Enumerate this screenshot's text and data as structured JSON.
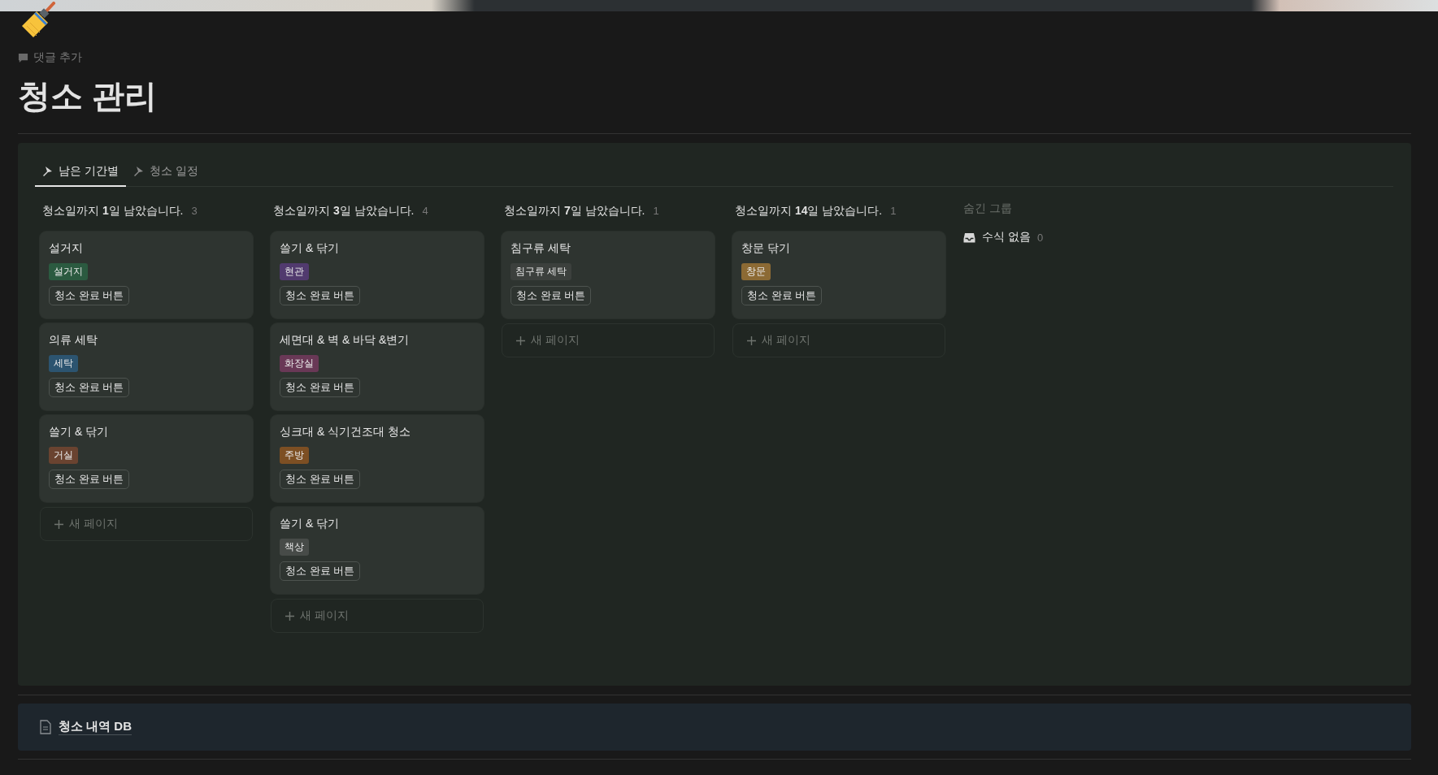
{
  "comment_action": "댓글 추가",
  "title": "청소 관리",
  "tabs": [
    {
      "label": "남은 기간별",
      "selected": true
    },
    {
      "label": "청소 일정",
      "selected": false
    }
  ],
  "groups": [
    {
      "title": "청소일까지 **1**일 남았습니다.",
      "count": "3",
      "new_page": "새 페이지",
      "cards": [
        {
          "title": "설거지",
          "tag": {
            "label": "설거지",
            "color": "#2b5a40"
          },
          "button": "청소 완료 버튼"
        },
        {
          "title": "의류 세탁",
          "tag": {
            "label": "세탁",
            "color": "#2c5470"
          },
          "button": "청소 완료 버튼"
        },
        {
          "title": "쓸기 & 닦기",
          "tag": {
            "label": "거실",
            "color": "#6a4330"
          },
          "button": "청소 완료 버튼"
        }
      ]
    },
    {
      "title": "청소일까지 **3**일 남았습니다.",
      "count": "4",
      "new_page": "새 페이지",
      "cards": [
        {
          "title": "쓸기 & 닦기",
          "tag": {
            "label": "현관",
            "color": "#513a6e"
          },
          "button": "청소 완료 버튼"
        },
        {
          "title": "세면대 & 벽 & 바닥 &변기",
          "tag": {
            "label": "화장실",
            "color": "#693856"
          },
          "button": "청소 완료 버튼"
        },
        {
          "title": "싱크대 & 식기건조대 청소",
          "tag": {
            "label": "주방",
            "color": "#7d4f23"
          },
          "button": "청소 완료 버튼"
        },
        {
          "title": "쓸기 & 닦기",
          "tag": {
            "label": "책상",
            "color": "#474b48"
          },
          "button": "청소 완료 버튼"
        }
      ]
    },
    {
      "title": "청소일까지 **7**일 남았습니다.",
      "count": "1",
      "new_page": "새 페이지",
      "cards": [
        {
          "title": "침구류 세탁",
          "tag": {
            "label": "침구류 세탁",
            "color": "#3c403d"
          },
          "button": "청소 완료 버튼"
        }
      ]
    },
    {
      "title": "청소일까지 **14**일 남았습니다.",
      "count": "1",
      "new_page": "새 페이지",
      "cards": [
        {
          "title": "창문 닦기",
          "tag": {
            "label": "창문",
            "color": "#8c6a34"
          },
          "button": "청소 완료 버튼"
        }
      ]
    }
  ],
  "hidden_groups": {
    "title": "숨긴 그룹",
    "items": [
      {
        "label": "수식 없음",
        "count": "0"
      }
    ]
  },
  "linked_page": "청소 내역 DB"
}
